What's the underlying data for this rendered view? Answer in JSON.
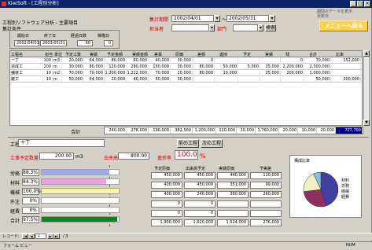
{
  "window": {
    "title": "KiwiSoft - [工程別分析]",
    "min": "_",
    "max": "□",
    "close": "×"
  },
  "topright_hint": "期間のデータを表示",
  "topright_hint2": "更新日",
  "menu_button": "メニューへ戻る",
  "header": {
    "title": "工程別ソフトウェア分析 - 主要項目",
    "label_prefix": "集計条件",
    "period_label": "集計期間",
    "period_from": "2002/04/01",
    "period_to": "2002/05/31",
    "mode_label": "担当者",
    "group_label": "部門",
    "range_btn": "検索",
    "radio_label": "表示",
    "panel_headers": [
      "開始日",
      "終了日",
      "経過日数",
      "稼働日"
    ],
    "panel_from": "2002/04/01",
    "panel_to": "2003/05/31",
    "panel_days": "60",
    "panel_work": "0"
  },
  "grid": {
    "columns": [
      "工程名",
      "担当",
      "単位",
      "予定工数",
      "実績",
      "予定金額",
      "実績金額",
      "差異",
      "原価",
      "差額",
      "進捗",
      "予定",
      "実績",
      "残",
      "合計",
      "比率"
    ],
    "rows": [
      {
        "name": "一丁",
        "a": "100",
        "b": "m3",
        "c": "20,000",
        "d": "64,000",
        "e": "80,000",
        "f": "60,000",
        "g": "40,000",
        "h": "30,000",
        "i": "0",
        "j": "",
        "k": "",
        "l": "",
        "m": "0",
        "n": "70,000",
        "o": "152,000"
      },
      {
        "name": "造成工",
        "a": "200",
        "b": "m",
        "c": "30,000",
        "d": "80,000",
        "e": "120,000",
        "f": "280,000",
        "g": "150,000",
        "h": "30,000",
        "i": "80,000",
        "j": "50,000",
        "k": "5,000",
        "l": "25,000",
        "m": "2,200,000",
        "n": "2,300,000",
        "o": ""
      },
      {
        "name": "舗装工",
        "a": "10",
        "b": "m2",
        "c": "70,000",
        "d": "70,000",
        "e": "1,200,000",
        "f": "1,222,000",
        "g": "70,000",
        "h": "20,000",
        "i": "80,000",
        "j": "10,000",
        "k": "",
        "l": "25,000",
        "m": "200,000",
        "n": "1,000,000",
        "o": ""
      },
      {
        "name": "雑工",
        "a": "10",
        "b": "m",
        "c": "50,000",
        "d": "64,000",
        "e": "20,000",
        "f": "40,000",
        "g": "50,000",
        "h": "30,000",
        "i": "",
        "j": "",
        "k": "",
        "l": "",
        "m": "",
        "n": "50,000",
        "o": "200,000"
      }
    ],
    "totals_label": "合計",
    "totals": [
      "240,000",
      "278,000",
      "190,000",
      "382,500",
      "1,200,000",
      "120,000",
      "10,000",
      "1,760,000",
      "20,000",
      "10,000",
      "20,000",
      "727,700"
    ]
  },
  "detail": {
    "name_label": "工程",
    "name_value": "十丁",
    "btn_prev": "前の工程",
    "btn_next": "次の工程",
    "qty_label": "工事予定数量",
    "qty_value": "200.00",
    "qty_unit": "m3",
    "rate_label": "出来高",
    "rate_value": "800.00",
    "progress_label": "進捗率",
    "progress_value": "100.0",
    "progress_unit": "%"
  },
  "bars": [
    {
      "label": "労務",
      "pct": "88.3%",
      "value": 0.88,
      "color": "#a0a8f0"
    },
    {
      "label": "材料",
      "pct": "84.3%",
      "value": 0.84,
      "color": "#f0a0e0"
    },
    {
      "label": "機械",
      "pct": "100.0%",
      "value": 1.0,
      "color": "#f8f8a0"
    },
    {
      "label": "外注",
      "pct": "0%",
      "value": 0.0,
      "color": "#c0e0f0"
    },
    {
      "label": "経費",
      "pct": "0%",
      "value": 0.0,
      "color": "#c0c0c0"
    },
    {
      "label": "合計",
      "pct": "97.5%",
      "value": 0.975,
      "color": "#108020"
    }
  ],
  "summary": {
    "headers": [
      "予定原価",
      "出来高予定",
      "実績原価",
      "予実差"
    ],
    "rows": [
      [
        "450,000",
        "450,000",
        "440,000",
        "110,000"
      ],
      [
        "400,000",
        "450,000",
        "351,000",
        "99,000"
      ],
      [
        "400,000",
        "240,000",
        "380,000",
        "260,000"
      ],
      [
        "0",
        "0",
        "",
        ""
      ],
      [
        "0",
        "0",
        "",
        ""
      ],
      [
        "1,900,000",
        "1,620,000",
        "1,524,000",
        "276,000"
      ]
    ]
  },
  "pie": {
    "title": "構成比率",
    "labels": [
      "材料",
      "労務",
      "機械",
      "経費"
    ]
  },
  "statusbar": {
    "record_label": "レコード:",
    "nav_first": "|◀",
    "nav_prev": "◀",
    "record_num": "1",
    "nav_next": "▶",
    "nav_last": "▶|",
    "record_total": "/ 3",
    "mode": "フォーム ビュー",
    "num": "NUM"
  },
  "chart_data": {
    "type": "pie",
    "title": "構成比率",
    "labels": [
      "材料",
      "労務",
      "機械",
      "経費"
    ],
    "values": [
      45,
      28,
      20,
      7
    ],
    "colors": [
      "#4040a0",
      "#903060",
      "#f0f0c0",
      "#80c0e0"
    ]
  }
}
